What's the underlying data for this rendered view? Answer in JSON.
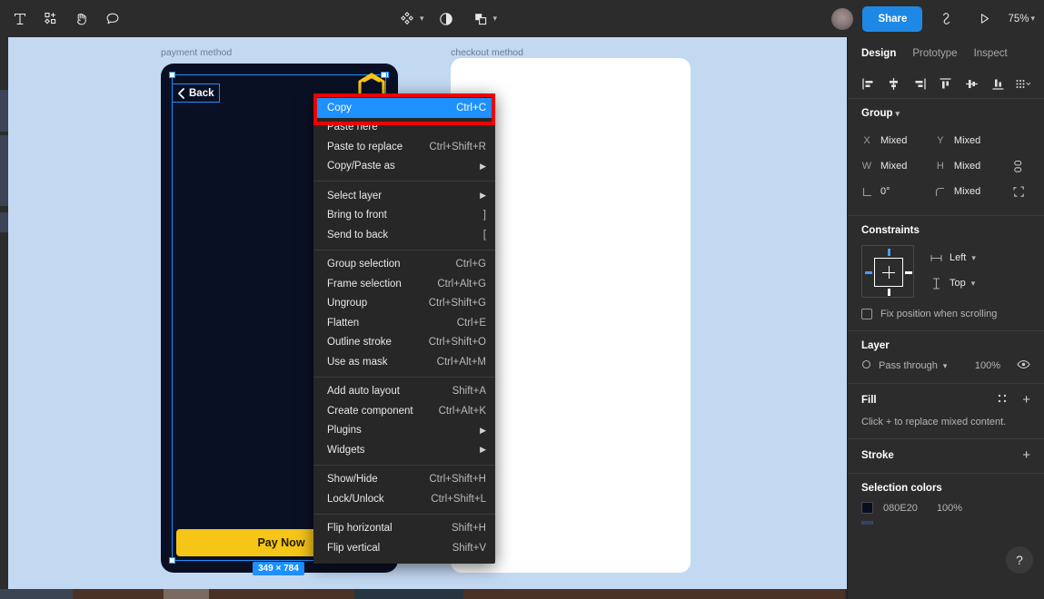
{
  "toolbar": {
    "tools": [
      {
        "name": "text-tool",
        "icon": "T"
      },
      {
        "name": "components-tool",
        "icon": "components"
      },
      {
        "name": "hand-tool",
        "icon": "hand"
      },
      {
        "name": "comment-tool",
        "icon": "comment"
      }
    ],
    "center_tools": [
      {
        "name": "move-tool",
        "icon": "diamond-cluster",
        "has_caret": true
      },
      {
        "name": "mask-tool",
        "icon": "half-circle",
        "has_caret": false
      },
      {
        "name": "boolean-tool",
        "icon": "union-shapes",
        "has_caret": true
      }
    ],
    "share_label": "Share",
    "link_icon": "link-icon",
    "present_icon": "play-icon",
    "zoom_level": "75%"
  },
  "canvas": {
    "frames": [
      {
        "label": "payment method",
        "back_label": "Back",
        "cta_label": "Pay Now"
      },
      {
        "label": "checkout method"
      }
    ],
    "selection_dimensions": "349 × 784"
  },
  "context_menu": {
    "groups": [
      [
        {
          "label": "Copy",
          "shortcut": "Ctrl+C",
          "selected": true,
          "submenu": false
        },
        {
          "label": "Paste here",
          "shortcut": "",
          "selected": false,
          "submenu": false
        },
        {
          "label": "Paste to replace",
          "shortcut": "Ctrl+Shift+R",
          "selected": false,
          "submenu": false
        },
        {
          "label": "Copy/Paste as",
          "shortcut": "",
          "selected": false,
          "submenu": true
        }
      ],
      [
        {
          "label": "Select layer",
          "shortcut": "",
          "selected": false,
          "submenu": true
        },
        {
          "label": "Bring to front",
          "shortcut": "]",
          "selected": false,
          "submenu": false
        },
        {
          "label": "Send to back",
          "shortcut": "[",
          "selected": false,
          "submenu": false
        }
      ],
      [
        {
          "label": "Group selection",
          "shortcut": "Ctrl+G",
          "selected": false,
          "submenu": false
        },
        {
          "label": "Frame selection",
          "shortcut": "Ctrl+Alt+G",
          "selected": false,
          "submenu": false
        },
        {
          "label": "Ungroup",
          "shortcut": "Ctrl+Shift+G",
          "selected": false,
          "submenu": false
        },
        {
          "label": "Flatten",
          "shortcut": "Ctrl+E",
          "selected": false,
          "submenu": false
        },
        {
          "label": "Outline stroke",
          "shortcut": "Ctrl+Shift+O",
          "selected": false,
          "submenu": false
        },
        {
          "label": "Use as mask",
          "shortcut": "Ctrl+Alt+M",
          "selected": false,
          "submenu": false
        }
      ],
      [
        {
          "label": "Add auto layout",
          "shortcut": "Shift+A",
          "selected": false,
          "submenu": false
        },
        {
          "label": "Create component",
          "shortcut": "Ctrl+Alt+K",
          "selected": false,
          "submenu": false
        },
        {
          "label": "Plugins",
          "shortcut": "",
          "selected": false,
          "submenu": true
        },
        {
          "label": "Widgets",
          "shortcut": "",
          "selected": false,
          "submenu": true
        }
      ],
      [
        {
          "label": "Show/Hide",
          "shortcut": "Ctrl+Shift+H",
          "selected": false,
          "submenu": false
        },
        {
          "label": "Lock/Unlock",
          "shortcut": "Ctrl+Shift+L",
          "selected": false,
          "submenu": false
        }
      ],
      [
        {
          "label": "Flip horizontal",
          "shortcut": "Shift+H",
          "selected": false,
          "submenu": false
        },
        {
          "label": "Flip vertical",
          "shortcut": "Shift+V",
          "selected": false,
          "submenu": false
        }
      ]
    ],
    "highlight_color": "#1e90ff",
    "annotation_box_color": "#ee0000"
  },
  "right_panel": {
    "tabs": [
      {
        "label": "Design",
        "active": true
      },
      {
        "label": "Prototype",
        "active": false
      },
      {
        "label": "Inspect",
        "active": false
      }
    ],
    "align_buttons": [
      {
        "name": "align-left"
      },
      {
        "name": "align-horizontal-center"
      },
      {
        "name": "align-right"
      },
      {
        "name": "align-top"
      },
      {
        "name": "align-vertical-center"
      },
      {
        "name": "align-bottom"
      },
      {
        "name": "distribute-more"
      }
    ],
    "group": {
      "title": "Group",
      "props": [
        {
          "key": "X",
          "value": "Mixed"
        },
        {
          "key": "Y",
          "value": "Mixed"
        },
        {
          "key": "W",
          "value": "Mixed"
        },
        {
          "key": "H",
          "value": "Mixed"
        },
        {
          "key": "rotation",
          "value": "0°"
        },
        {
          "key": "corner-radius",
          "value": "Mixed"
        }
      ]
    },
    "constraints": {
      "title": "Constraints",
      "horizontal": "Left",
      "vertical": "Top",
      "fix_position_label": "Fix position when scrolling",
      "fix_position_checked": false
    },
    "layer": {
      "title": "Layer",
      "blend_mode": "Pass through",
      "opacity": "100%"
    },
    "fill": {
      "title": "Fill",
      "hint": "Click + to replace mixed content."
    },
    "stroke": {
      "title": "Stroke"
    },
    "selection_colors": {
      "title": "Selection colors",
      "items": [
        {
          "hex": "080E20",
          "swatch": "#080e20",
          "opacity": "100%"
        }
      ]
    },
    "help_label": "?"
  }
}
